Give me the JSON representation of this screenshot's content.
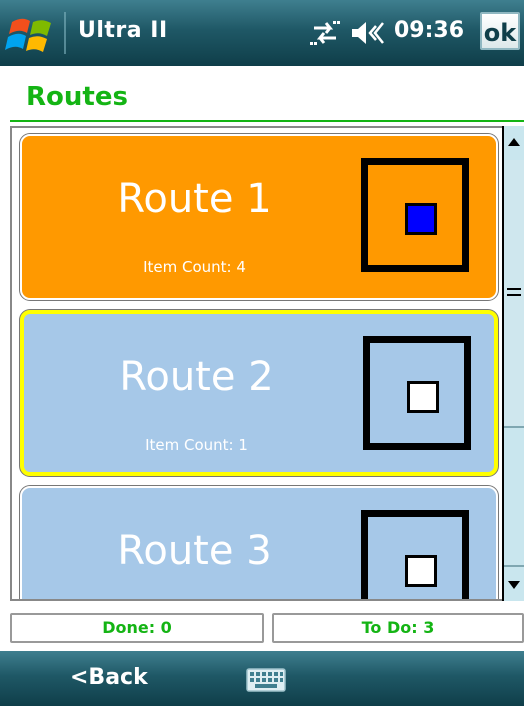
{
  "titlebar": {
    "app_title": "Ultra II",
    "time": "09:36",
    "ok_label": "ok",
    "icons": [
      "windows-start-icon",
      "connectivity-icon",
      "volume-icon"
    ]
  },
  "header": {
    "title": "Routes"
  },
  "routes": [
    {
      "name": "Route 1",
      "count_text": "Item Count: 4",
      "bg": "#FF9900",
      "border": "#ffffff",
      "checkbox_fill": "#0000FF",
      "state": "selected-filled"
    },
    {
      "name": "Route 2",
      "count_text": "Item Count: 1",
      "bg": "#A6C8E8",
      "border": "#FFFF00",
      "checkbox_fill": "#FFFFFF",
      "state": "highlighted"
    },
    {
      "name": "Route 3",
      "count_text": "",
      "bg": "#A6C8E8",
      "border": "#ffffff",
      "checkbox_fill": "#FFFFFF",
      "state": "normal"
    }
  ],
  "status": {
    "done_label": "Done: 0",
    "todo_label": "To Do: 3"
  },
  "bottombar": {
    "back_label": "<Back",
    "keyboard_icon": "keyboard-icon"
  },
  "colors": {
    "accent_green": "#14B414",
    "titlebar": "#1F5866"
  }
}
